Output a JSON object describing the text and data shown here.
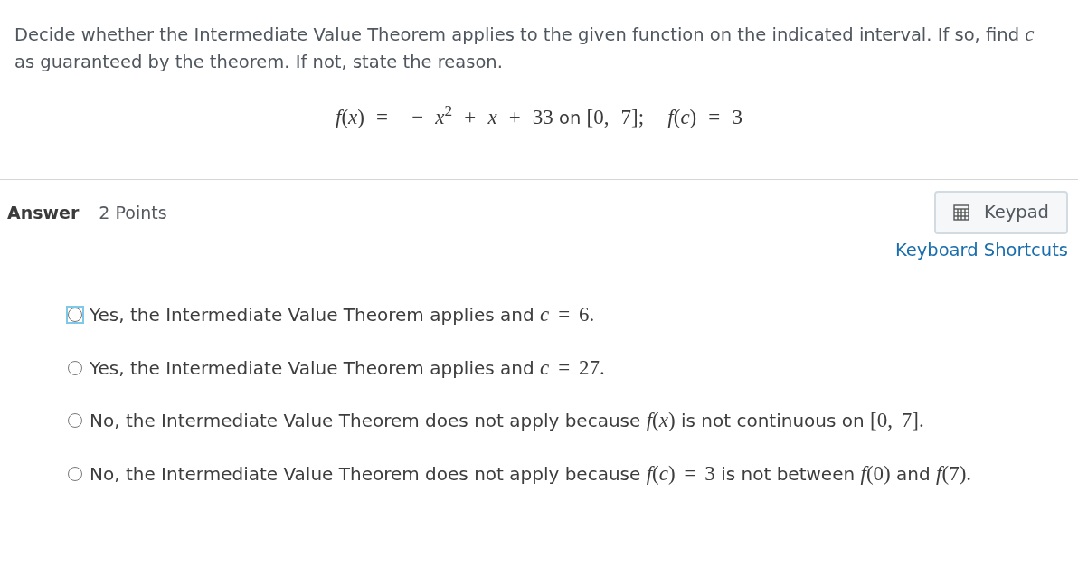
{
  "question": {
    "prompt": [
      {
        "kind": "text",
        "text": "Decide whether the Intermediate Value Theorem applies to the given function on the indicated interval. If so, find "
      },
      {
        "kind": "math",
        "text": "*c*"
      },
      {
        "kind": "text",
        "text": " as guaranteed by the theorem. If not, state the reason."
      }
    ],
    "formula": [
      {
        "kind": "math",
        "text": "*f*(*x*) =  − *x*$^{2}$ + *x* + 33"
      },
      {
        "kind": "text",
        "text": " on "
      },
      {
        "kind": "math",
        "text": "[0, 7];  *f*(*c*) = 3"
      }
    ]
  },
  "answer": {
    "label": "Answer",
    "points": "2 Points",
    "keypad_button": "Keypad",
    "shortcuts_link": "Keyboard Shortcuts"
  },
  "options": [
    {
      "selected": false,
      "focused": true,
      "label": [
        {
          "kind": "text",
          "text": "Yes, the Intermediate Value Theorem applies and "
        },
        {
          "kind": "math",
          "text": "*c* = 6."
        }
      ]
    },
    {
      "selected": false,
      "focused": false,
      "label": [
        {
          "kind": "text",
          "text": "Yes, the Intermediate Value Theorem applies and "
        },
        {
          "kind": "math",
          "text": "*c* = 27."
        }
      ]
    },
    {
      "selected": false,
      "focused": false,
      "label": [
        {
          "kind": "text",
          "text": "No, the Intermediate Value Theorem does not apply because "
        },
        {
          "kind": "math",
          "text": "*f*(*x*)"
        },
        {
          "kind": "text",
          "text": " is not continuous on "
        },
        {
          "kind": "math",
          "text": "[0, 7]."
        }
      ]
    },
    {
      "selected": false,
      "focused": false,
      "label": [
        {
          "kind": "text",
          "text": "No, the Intermediate Value Theorem does not apply because "
        },
        {
          "kind": "math",
          "text": "*f*(*c*) = 3"
        },
        {
          "kind": "text",
          "text": " is not between "
        },
        {
          "kind": "math",
          "text": "*f*(0)"
        },
        {
          "kind": "text",
          "text": " and "
        },
        {
          "kind": "math",
          "text": "*f*(7)."
        }
      ]
    }
  ]
}
